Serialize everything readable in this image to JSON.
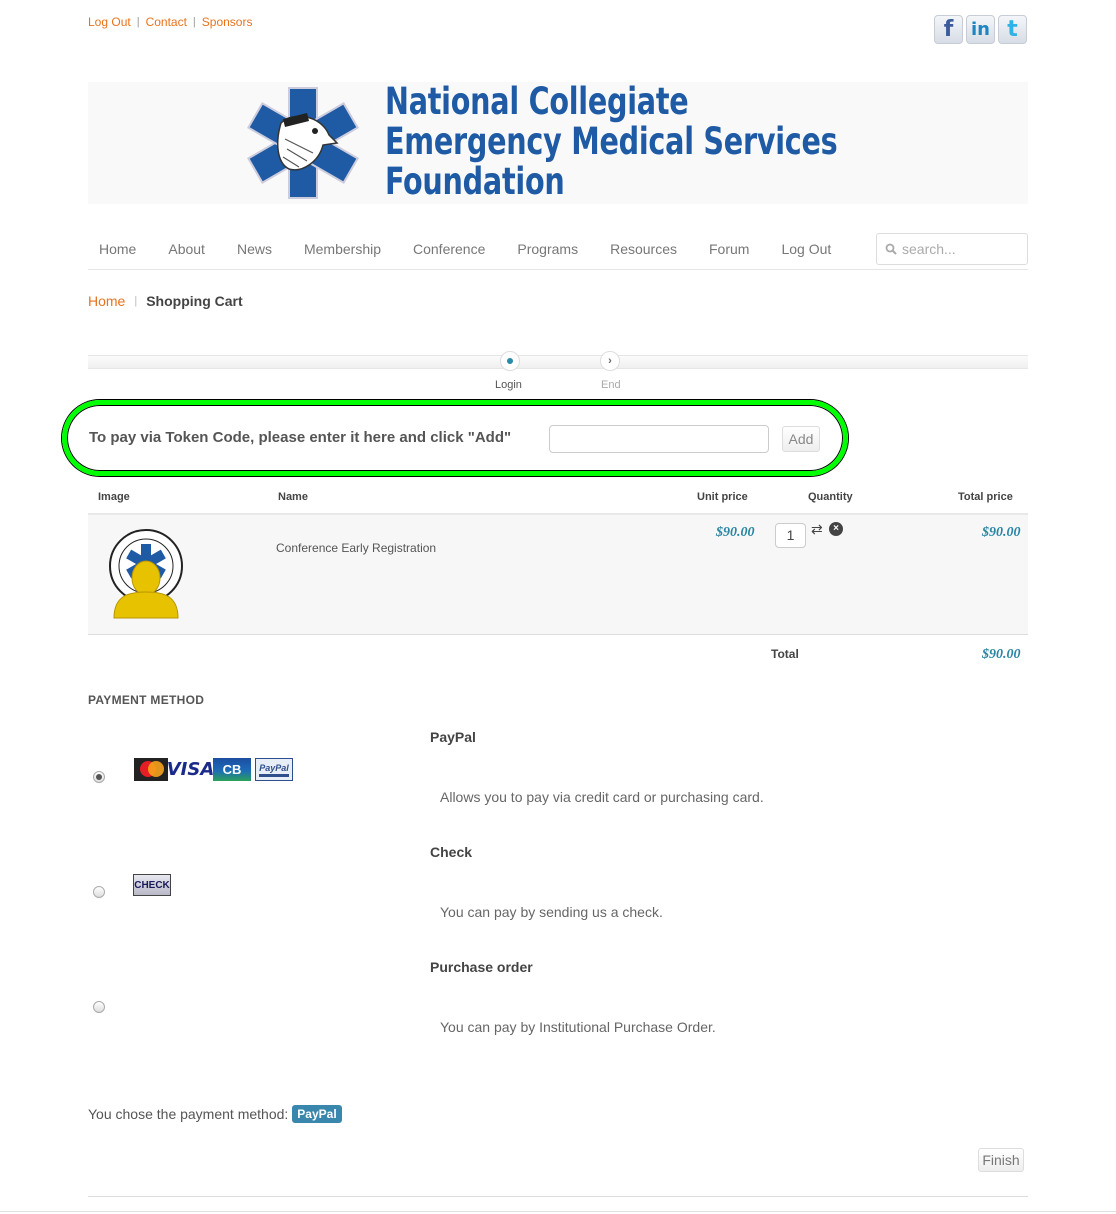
{
  "top_links": [
    "Log Out",
    "Contact",
    "Sponsors"
  ],
  "social": [
    {
      "name": "facebook-icon",
      "glyph": "f"
    },
    {
      "name": "linkedin-icon",
      "glyph": "in"
    },
    {
      "name": "twitter-icon",
      "glyph": "t"
    }
  ],
  "logo": {
    "lines": [
      "National Collegiate",
      "Emergency Medical Services",
      "Foundation"
    ]
  },
  "nav": {
    "items": [
      "Home",
      "About",
      "News",
      "Membership",
      "Conference",
      "Programs",
      "Resources",
      "Forum",
      "Log Out"
    ],
    "search_placeholder": "search..."
  },
  "breadcrumb": {
    "home": "Home",
    "current": "Shopping Cart"
  },
  "steps": [
    {
      "label": "Login",
      "state": "current"
    },
    {
      "label": "End",
      "state": "next"
    }
  ],
  "token": {
    "label": "To pay via Token Code, please enter it here and click \"Add\"",
    "value": "",
    "button": "Add"
  },
  "cart": {
    "headers": {
      "image": "Image",
      "name": "Name",
      "unit_price": "Unit price",
      "quantity": "Quantity",
      "total_price": "Total price"
    },
    "rows": [
      {
        "name": "Conference Early Registration",
        "unit_price": "$90.00",
        "quantity": "1",
        "total_price": "$90.00"
      }
    ],
    "total_label": "Total",
    "total": "$90.00"
  },
  "payment": {
    "title": "PAYMENT METHOD",
    "methods": [
      {
        "name": "PayPal",
        "description": "Allows you to pay via credit card or purchasing card.",
        "selected": true,
        "logos": [
          "MasterCard",
          "VISA",
          "CB",
          "PayPal"
        ]
      },
      {
        "name": "Check",
        "description": "You can pay by sending us a check.",
        "selected": false,
        "logos": [
          "CHECK"
        ]
      },
      {
        "name": "Purchase order",
        "description": "You can pay by Institutional Purchase Order.",
        "selected": false,
        "logos": []
      }
    ],
    "chosen_label": "You chose the payment method:",
    "chosen_value": "PayPal"
  },
  "finish_button": "Finish",
  "colors": {
    "link": "#e8731e",
    "price": "#2a86a3",
    "logo": "#1f5aa5",
    "highlight": "#00ff00",
    "badge": "#3a87ad"
  }
}
